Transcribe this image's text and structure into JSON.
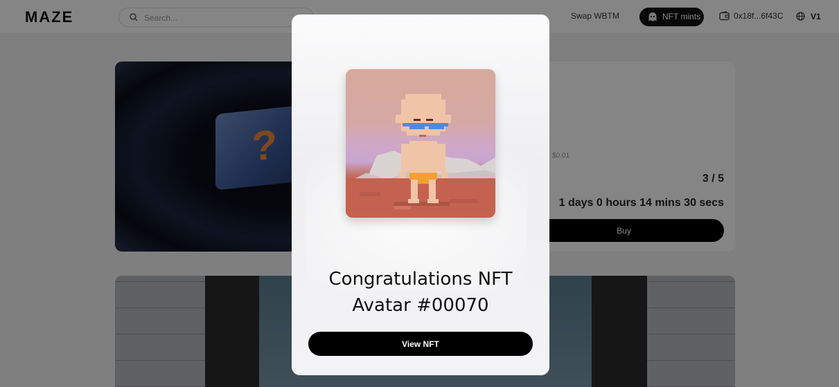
{
  "header": {
    "logo_text": "MAZE",
    "search_placeholder": "Search...",
    "nav": {
      "swap_label": "Swap WBTM",
      "nft_mints_label": "NFT mints",
      "wallet_address": "0x18f...6f43C",
      "language": "V1"
    }
  },
  "background_card": {
    "price_note": "$0.01",
    "supply": "3 / 5",
    "countdown": "1 days 0 hours 14 mins 30 secs",
    "buy_label": "Buy",
    "mystery_glyph": "?"
  },
  "modal": {
    "title_line1": "Congratulations NFT",
    "title_line2": "Avatar #00070",
    "view_button_label": "View NFT"
  },
  "icons": {
    "search": "search-icon",
    "nft": "ghost-icon",
    "wallet": "wallet-icon",
    "language": "globe-icon"
  },
  "colors": {
    "accent": "#000000",
    "overlay": "#00000080"
  }
}
